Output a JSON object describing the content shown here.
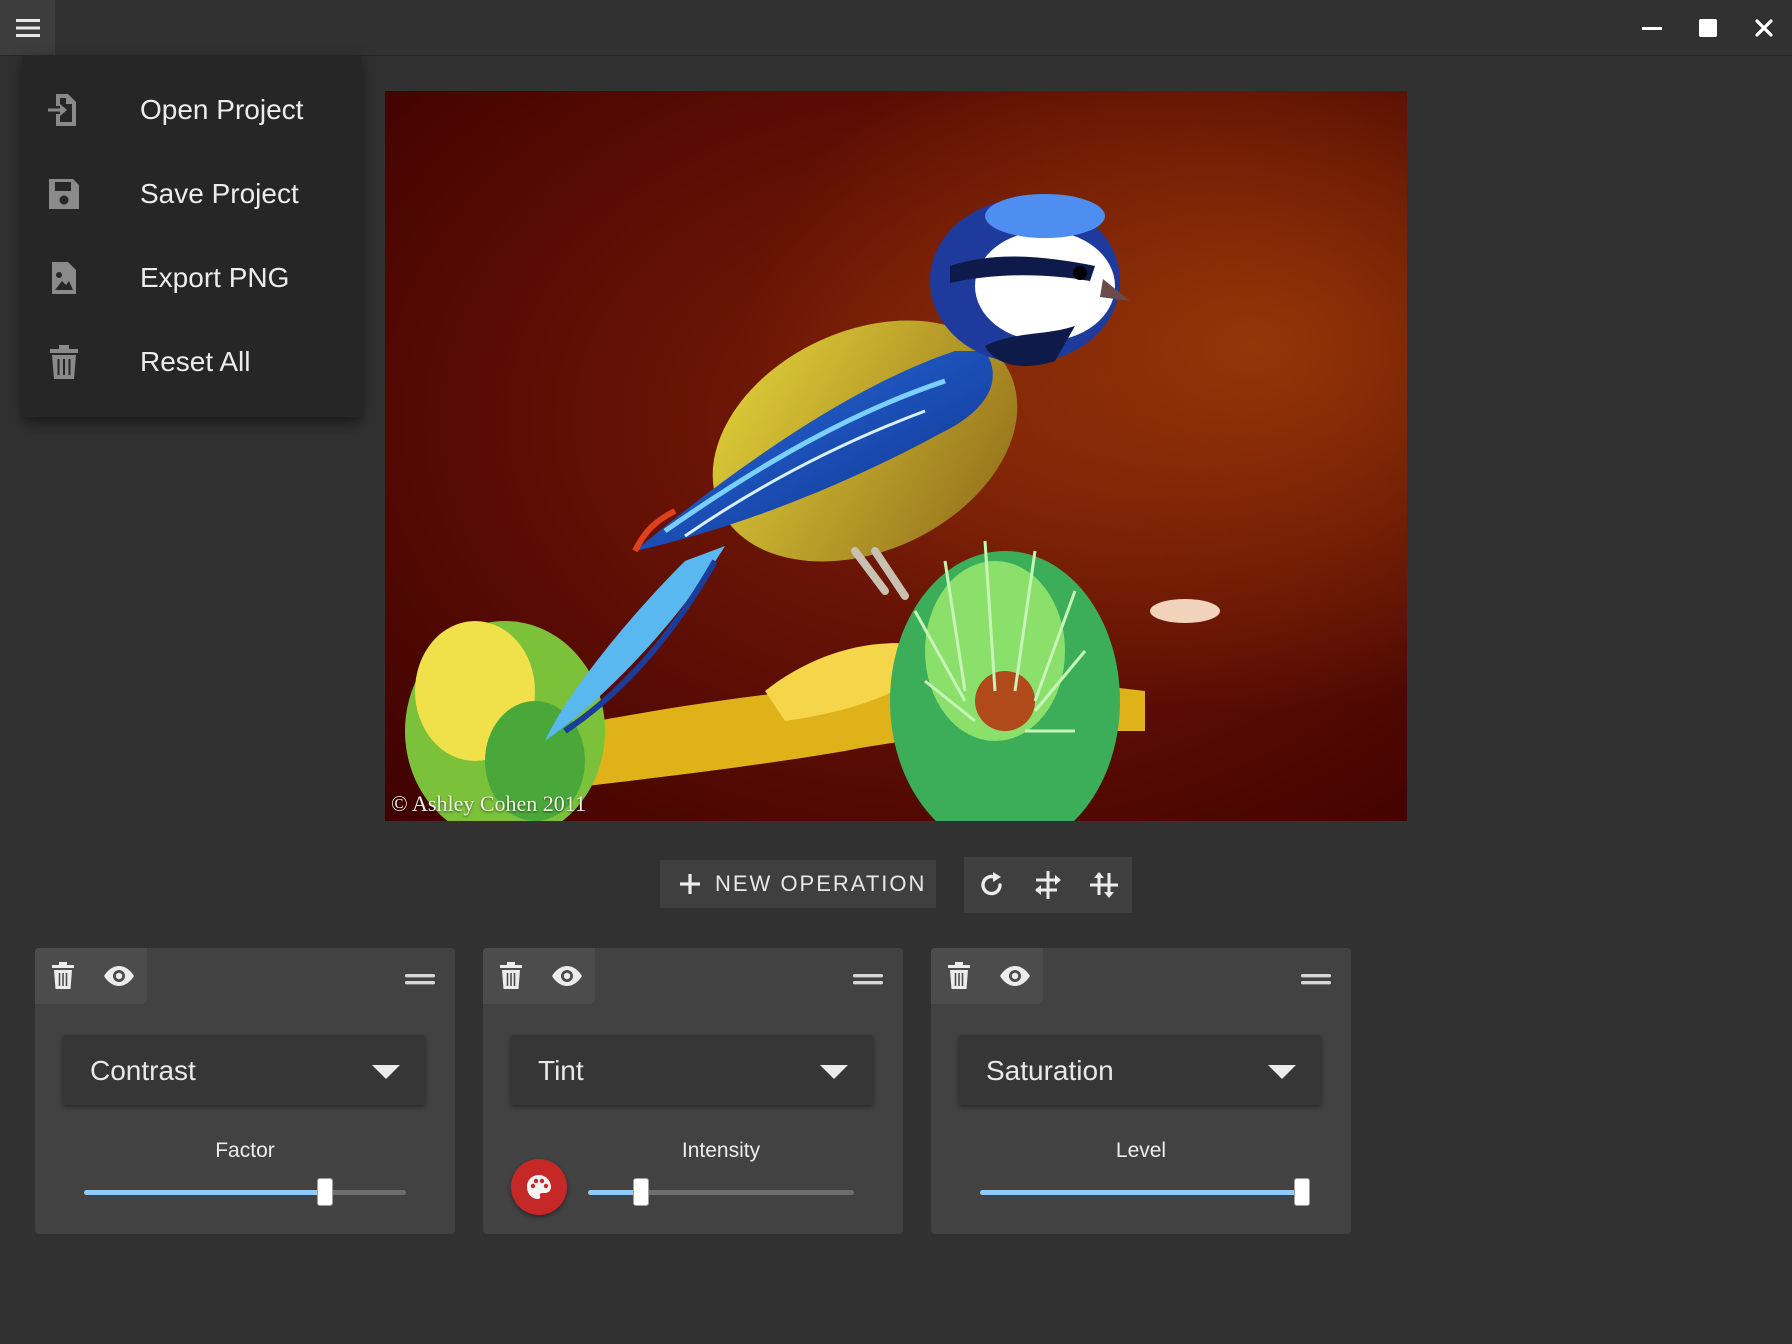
{
  "titlebar": {
    "menu_icon": "hamburger-menu-icon",
    "window_controls": [
      "minimize-icon",
      "maximize-icon",
      "close-icon"
    ]
  },
  "menu": {
    "items": [
      {
        "label": "Open Project",
        "icon": "file-import-icon"
      },
      {
        "label": "Save Project",
        "icon": "floppy-disk-icon"
      },
      {
        "label": "Export PNG",
        "icon": "file-image-icon"
      },
      {
        "label": "Reset All",
        "icon": "trash-icon"
      }
    ]
  },
  "image": {
    "credit": "© Ashley Cohen 2011"
  },
  "toolbar": {
    "new_operation_label": "NEW OPERATION",
    "tools": [
      "rotate-icon",
      "flip-horizontal-icon",
      "flip-vertical-icon"
    ]
  },
  "operations": [
    {
      "name": "Contrast",
      "param_label": "Factor",
      "value_fraction": 0.75,
      "has_color": false
    },
    {
      "name": "Tint",
      "param_label": "Intensity",
      "value_fraction": 0.2,
      "has_color": true
    },
    {
      "name": "Saturation",
      "param_label": "Level",
      "value_fraction": 1.0,
      "has_color": false
    }
  ],
  "colors": {
    "background": "#313131",
    "card": "#424242",
    "slider_accent": "#90caf9",
    "tint_color": "#c62828"
  }
}
